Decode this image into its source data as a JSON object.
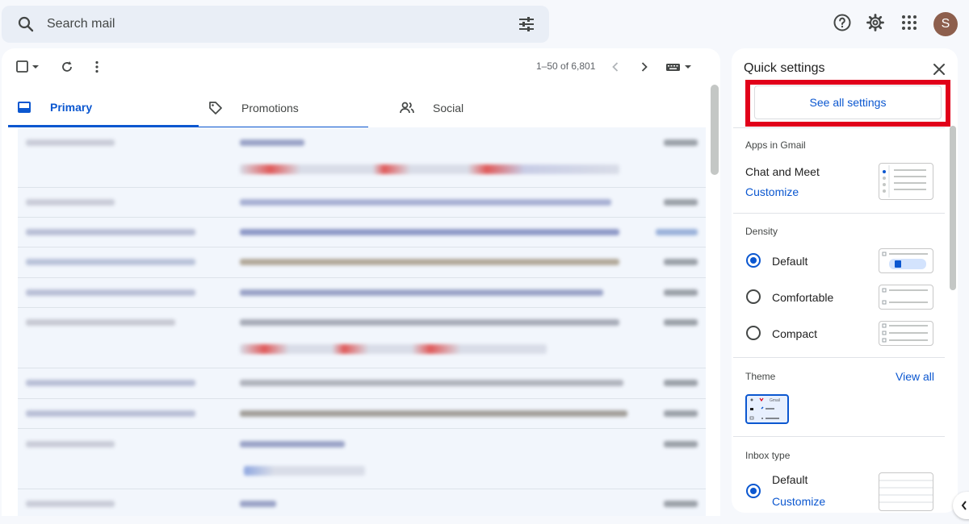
{
  "search": {
    "placeholder": "Search mail"
  },
  "header": {
    "avatar_letter": "S"
  },
  "toolbar": {
    "page_info": "1–50 of 6,801"
  },
  "tabs": [
    {
      "label": "Primary"
    },
    {
      "label": "Promotions"
    },
    {
      "label": "Social"
    }
  ],
  "quick_settings": {
    "title": "Quick settings",
    "see_all": "See all settings",
    "apps_section": "Apps in Gmail",
    "apps_item": "Chat and Meet",
    "apps_customize": "Customize",
    "density_section": "Density",
    "density_options": [
      {
        "label": "Default",
        "selected": true
      },
      {
        "label": "Comfortable",
        "selected": false
      },
      {
        "label": "Compact",
        "selected": false
      }
    ],
    "theme_section": "Theme",
    "theme_view_all": "View all",
    "theme_thumb_text": "Gmail",
    "inbox_section": "Inbox type",
    "inbox_default": "Default",
    "inbox_customize": "Customize"
  },
  "colors": {
    "accent": "#0b57d0",
    "highlight_box": "#e1001a",
    "avatar": "#8d5f4d"
  }
}
